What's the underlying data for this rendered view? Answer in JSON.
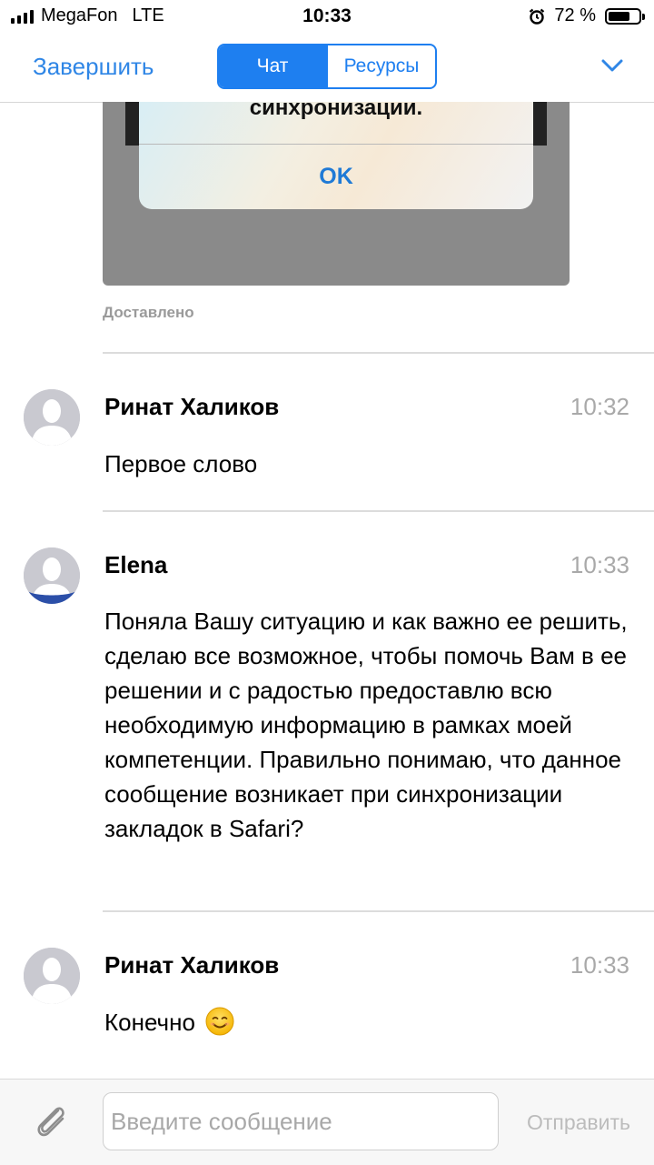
{
  "status_bar": {
    "carrier": "MegaFon",
    "network": "LTE",
    "time": "10:33",
    "battery_text": "72 %",
    "battery_level": 0.72
  },
  "nav": {
    "done_label": "Завершить",
    "tab_chat": "Чат",
    "tab_resources": "Ресурсы",
    "active_tab": "Чат",
    "accent_color": "#1e7ff0"
  },
  "attachment": {
    "alert_text": "синхронизации.",
    "ok_label": "OK"
  },
  "delivered_label": "Доставлено",
  "messages": [
    {
      "author": "Ринат Халиков",
      "time": "10:32",
      "text": "Первое слово"
    },
    {
      "author": "Elena",
      "time": "10:33",
      "text": "Поняла Вашу ситуацию и как важно ее решить, сделаю все возможное, чтобы помочь Вам в ее решении и с радостью предоставлю всю необходимую информацию в рамках моей компетенции. Правильно понимаю, что данное сообщение возникает при синхронизации закладок в Safari?"
    },
    {
      "author": "Ринат Халиков",
      "time": "10:33",
      "text": "Конечно",
      "emoji": "smiling-face-icon"
    }
  ],
  "composer": {
    "placeholder": "Введите сообщение",
    "value": "",
    "send_label": "Отправить",
    "attach_icon": "paperclip-icon"
  }
}
